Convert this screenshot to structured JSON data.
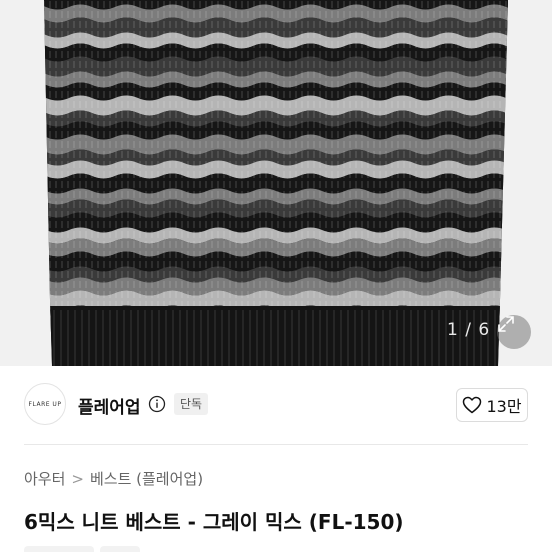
{
  "gallery": {
    "counter": "1 / 6",
    "accent_colors": [
      "#161616",
      "#3a3a3a",
      "#7c7c7c",
      "#b5b5b5"
    ]
  },
  "seller": {
    "logo_text": "FLARE UP",
    "name": "플레어업",
    "badge": "단독"
  },
  "like": {
    "count": "13만"
  },
  "breadcrumb": {
    "items": [
      "아우터",
      "베스트 (플레어업)"
    ],
    "separator": ">"
  },
  "product": {
    "title": "6믹스 니트 베스트 - 그레이 믹스 (FL-150)"
  }
}
